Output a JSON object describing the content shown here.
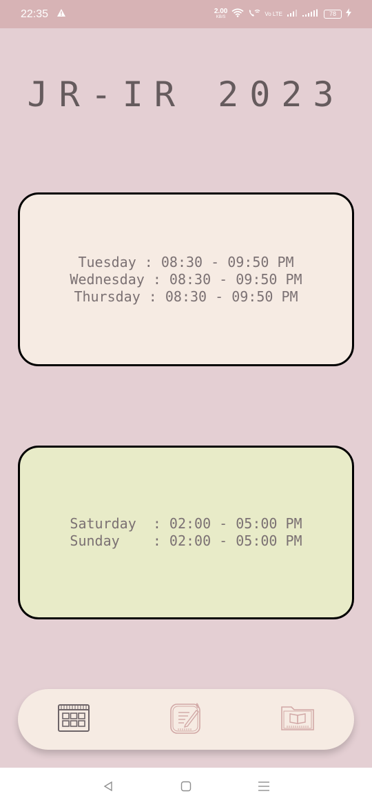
{
  "status_bar": {
    "time": "22:35",
    "speed_value": "2.00",
    "speed_unit": "KB/S",
    "volte_label": "Vo LTE",
    "battery": "78"
  },
  "app": {
    "title": "JR-IR 2023"
  },
  "schedule_cards": [
    {
      "background": "#f6ebe3",
      "lines": [
        "Tuesday : 08:30 - 09:50 PM",
        "Wednesday : 08:30 - 09:50 PM",
        "Thursday : 08:30 - 09:50 PM"
      ]
    },
    {
      "background": "#e8ebc8",
      "lines": [
        "Saturday  : 02:00 - 05:00 PM",
        "Sunday    : 02:00 - 05:00 PM"
      ]
    }
  ],
  "bottom_nav": {
    "items": [
      {
        "icon": "calendar-icon",
        "active": true
      },
      {
        "icon": "notes-icon",
        "active": false
      },
      {
        "icon": "book-folder-icon",
        "active": false
      }
    ]
  },
  "system_nav": {
    "icons": [
      "back-icon",
      "home-icon",
      "recents-icon"
    ]
  },
  "colors": {
    "background": "#e4cfd3",
    "status_bar": "#d7b3b5",
    "title_text": "#655b5d",
    "card_text": "#7b7173",
    "nav_active": "#6d6468",
    "nav_inactive": "#d1a8a6"
  }
}
